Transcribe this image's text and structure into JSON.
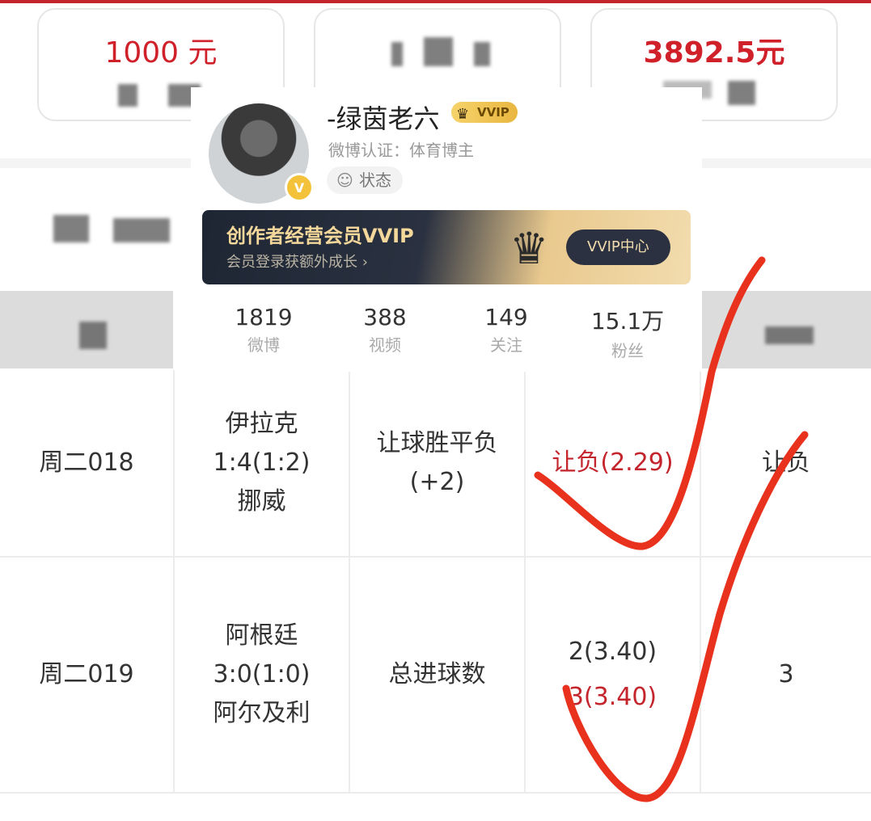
{
  "cards": [
    {
      "value": "1000 元"
    },
    {
      "value": ""
    },
    {
      "value": "3892.5元"
    }
  ],
  "profile": {
    "name": "-绿茵老六",
    "vip_badge": "VVIP",
    "certification": "微博认证：体育博主",
    "status_label": "状态",
    "banner_title": "创作者经营会员VVIP",
    "banner_subtitle": "会员登录获额外成长 ›",
    "banner_button": "VVIP中心",
    "stats": [
      {
        "number": "1819",
        "label": "微博"
      },
      {
        "number": "388",
        "label": "视频"
      },
      {
        "number": "149",
        "label": "关注"
      },
      {
        "number": "15.1万",
        "label": "粉丝"
      }
    ]
  },
  "table": {
    "rows": [
      {
        "match_no": "周二018",
        "team1": "伊拉克",
        "score": "1:4(1:2)",
        "team2": "挪威",
        "play_line1": "让球胜平负",
        "play_line2": "(+2)",
        "pick_line1": "让负(2.29)",
        "pick_line2": "",
        "result": "让负"
      },
      {
        "match_no": "周二019",
        "team1": "阿根廷",
        "score": "3:0(1:0)",
        "team2": "阿尔及利",
        "play_line1": "总进球数",
        "play_line2": "",
        "pick_line1": "2(3.40)",
        "pick_line2": "3(3.40)",
        "result": "3"
      }
    ]
  },
  "colors": {
    "accent": "#c4252c",
    "check": "#e8321e"
  }
}
